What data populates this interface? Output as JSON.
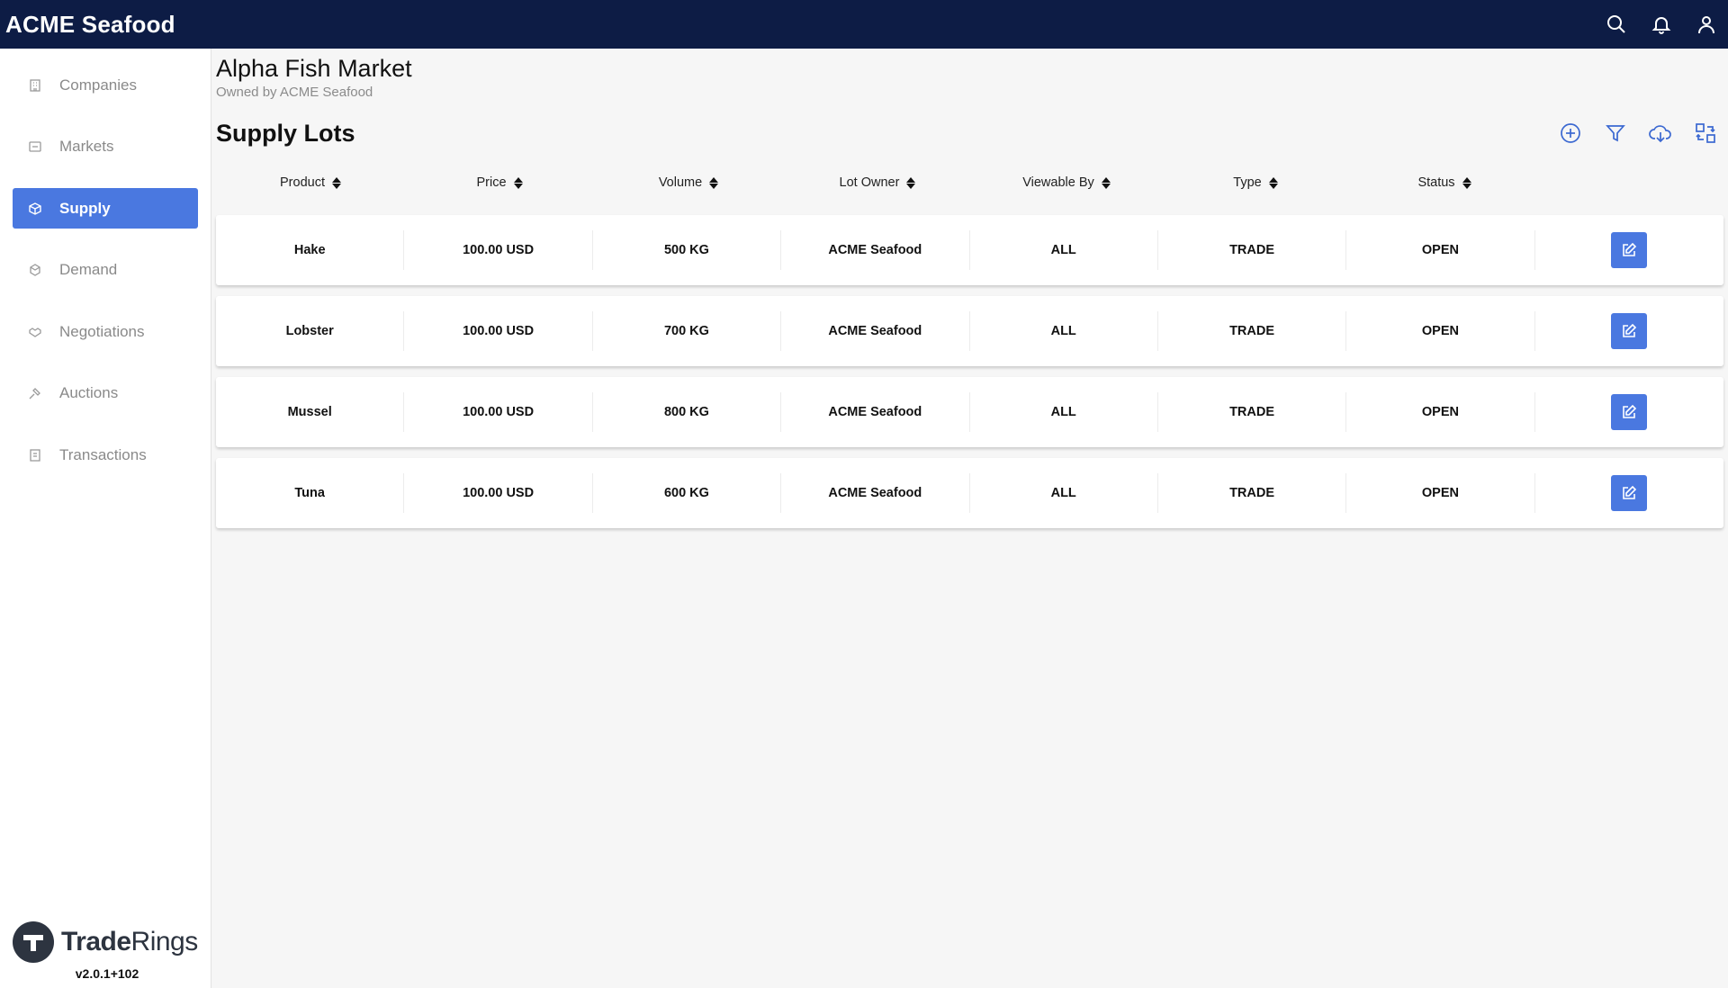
{
  "header": {
    "brand": "ACME Seafood",
    "icons": [
      "search-icon",
      "bell-icon",
      "user-icon"
    ]
  },
  "sidebar": {
    "items": [
      {
        "label": "Companies",
        "icon": "building-icon",
        "active": false
      },
      {
        "label": "Markets",
        "icon": "market-icon",
        "active": false
      },
      {
        "label": "Supply",
        "icon": "box-icon",
        "active": true
      },
      {
        "label": "Demand",
        "icon": "boxes-icon",
        "active": false
      },
      {
        "label": "Negotiations",
        "icon": "handshake-icon",
        "active": false
      },
      {
        "label": "Auctions",
        "icon": "gavel-icon",
        "active": false
      },
      {
        "label": "Transactions",
        "icon": "receipt-icon",
        "active": false
      }
    ],
    "logo": {
      "bold": "Trade",
      "light": "Rings"
    },
    "version": "v2.0.1+102"
  },
  "market": {
    "title": "Alpha Fish Market",
    "subtitle": "Owned by ACME Seafood"
  },
  "section": {
    "title": "Supply Lots",
    "tools": [
      "add-circle-icon",
      "filter-icon",
      "cloud-download-icon",
      "swap-icon"
    ]
  },
  "table": {
    "columns": [
      "Product",
      "Price",
      "Volume",
      "Lot Owner",
      "Viewable By",
      "Type",
      "Status"
    ],
    "rows": [
      {
        "product": "Hake",
        "price": "100.00 USD",
        "volume": "500 KG",
        "owner": "ACME Seafood",
        "viewable": "ALL",
        "type": "TRADE",
        "status": "OPEN"
      },
      {
        "product": "Lobster",
        "price": "100.00 USD",
        "volume": "700 KG",
        "owner": "ACME Seafood",
        "viewable": "ALL",
        "type": "TRADE",
        "status": "OPEN"
      },
      {
        "product": "Mussel",
        "price": "100.00 USD",
        "volume": "800 KG",
        "owner": "ACME Seafood",
        "viewable": "ALL",
        "type": "TRADE",
        "status": "OPEN"
      },
      {
        "product": "Tuna",
        "price": "100.00 USD",
        "volume": "600 KG",
        "owner": "ACME Seafood",
        "viewable": "ALL",
        "type": "TRADE",
        "status": "OPEN"
      }
    ]
  },
  "colors": {
    "topbar": "#0d1c45",
    "accent": "#4a78e0"
  }
}
